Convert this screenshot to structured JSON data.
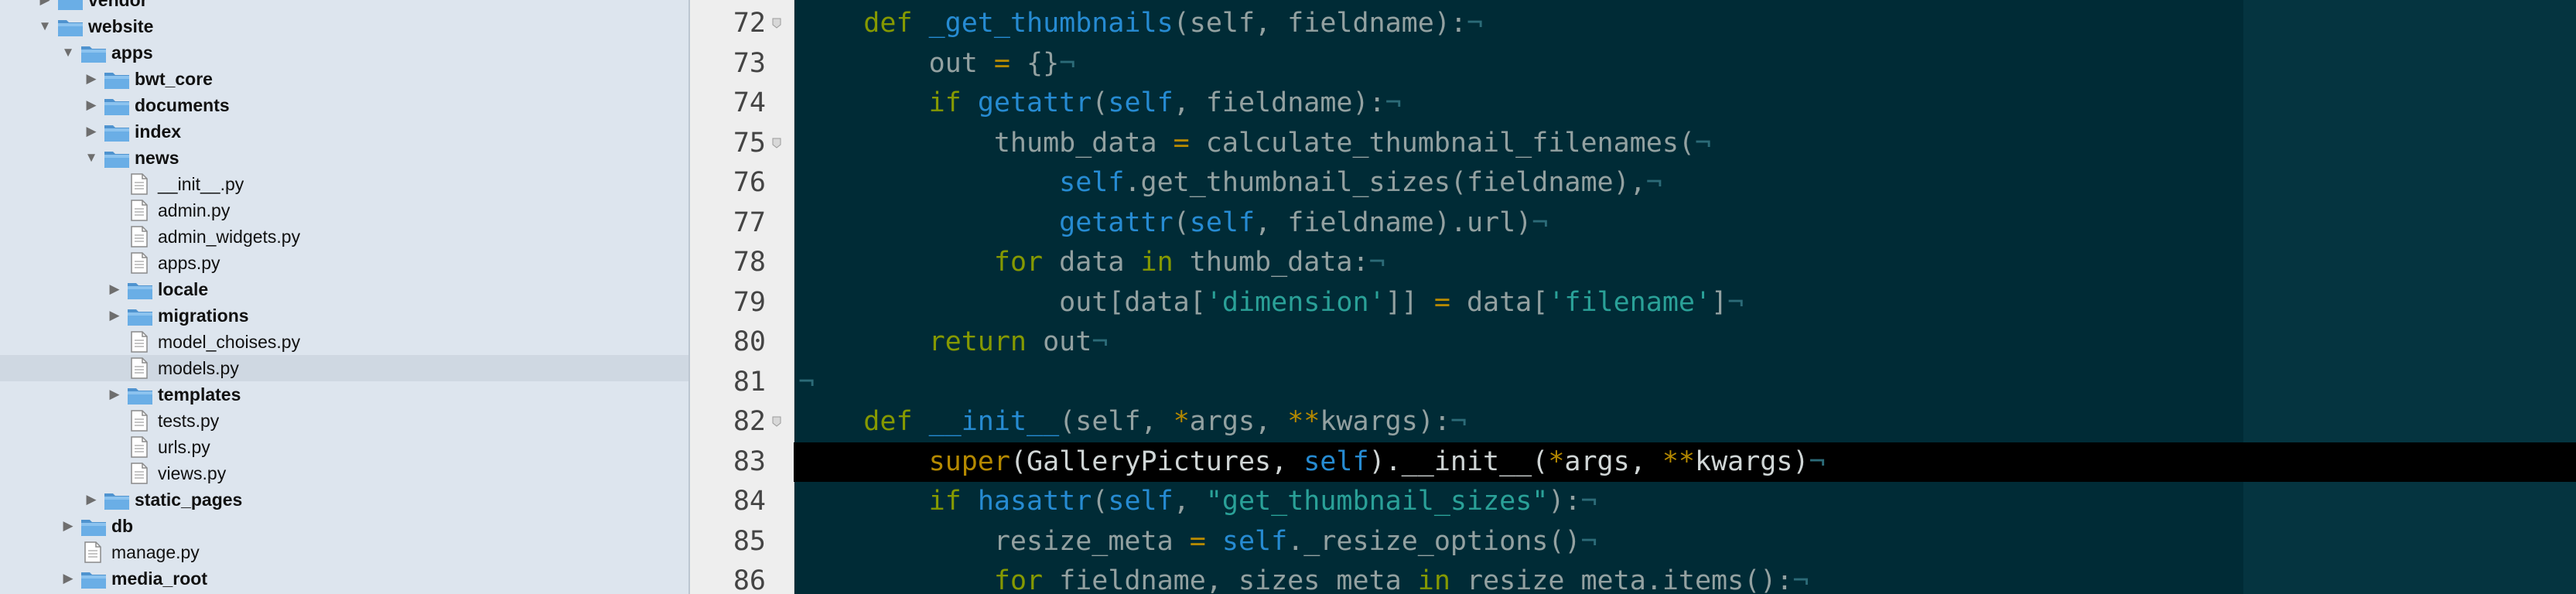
{
  "colors": {
    "sidebar_bg": "#dde5ee",
    "editor_bg": "#002b36",
    "current_line_bg": "#000000",
    "keyword": "#859900",
    "function": "#268bd2",
    "string": "#2aa198",
    "operator": "#b58900",
    "folder_icon": "#6aaee6"
  },
  "sidebar": {
    "items": [
      {
        "label": "vendor",
        "type": "folder",
        "depth": 1,
        "state": "collapsed"
      },
      {
        "label": "website",
        "type": "folder",
        "depth": 1,
        "state": "expanded"
      },
      {
        "label": "apps",
        "type": "folder",
        "depth": 2,
        "state": "expanded"
      },
      {
        "label": "bwt_core",
        "type": "folder",
        "depth": 3,
        "state": "collapsed"
      },
      {
        "label": "documents",
        "type": "folder",
        "depth": 3,
        "state": "collapsed"
      },
      {
        "label": "index",
        "type": "folder",
        "depth": 3,
        "state": "collapsed"
      },
      {
        "label": "news",
        "type": "folder",
        "depth": 3,
        "state": "expanded"
      },
      {
        "label": "__init__.py",
        "type": "file",
        "depth": 4
      },
      {
        "label": "admin.py",
        "type": "file",
        "depth": 4
      },
      {
        "label": "admin_widgets.py",
        "type": "file",
        "depth": 4
      },
      {
        "label": "apps.py",
        "type": "file",
        "depth": 4
      },
      {
        "label": "locale",
        "type": "folder",
        "depth": 4,
        "state": "collapsed"
      },
      {
        "label": "migrations",
        "type": "folder",
        "depth": 4,
        "state": "collapsed"
      },
      {
        "label": "model_choises.py",
        "type": "file",
        "depth": 4
      },
      {
        "label": "models.py",
        "type": "file",
        "depth": 4,
        "selected": true
      },
      {
        "label": "templates",
        "type": "folder",
        "depth": 4,
        "state": "collapsed"
      },
      {
        "label": "tests.py",
        "type": "file",
        "depth": 4
      },
      {
        "label": "urls.py",
        "type": "file",
        "depth": 4
      },
      {
        "label": "views.py",
        "type": "file",
        "depth": 4
      },
      {
        "label": "static_pages",
        "type": "folder",
        "depth": 3,
        "state": "collapsed"
      },
      {
        "label": "db",
        "type": "folder",
        "depth": 2,
        "state": "collapsed"
      },
      {
        "label": "manage.py",
        "type": "file",
        "depth": 2
      },
      {
        "label": "media_root",
        "type": "folder",
        "depth": 2,
        "state": "collapsed"
      },
      {
        "label": "",
        "type": "folder",
        "depth": 2,
        "state": "collapsed"
      }
    ]
  },
  "editor": {
    "current_line": 83,
    "lines": [
      {
        "n": "72",
        "fold": true,
        "tokens": [
          [
            "p",
            "    "
          ],
          [
            "kw",
            "def"
          ],
          [
            "p",
            " "
          ],
          [
            "fn",
            "_get_thumbnails"
          ],
          [
            "p",
            "(self, fieldname):"
          ],
          [
            "eol",
            "¬"
          ]
        ]
      },
      {
        "n": "73",
        "fold": false,
        "tokens": [
          [
            "p",
            "        out "
          ],
          [
            "op",
            "="
          ],
          [
            "p",
            " {}"
          ],
          [
            "eol",
            "¬"
          ]
        ]
      },
      {
        "n": "74",
        "fold": false,
        "tokens": [
          [
            "p",
            "        "
          ],
          [
            "kw",
            "if"
          ],
          [
            "p",
            " "
          ],
          [
            "fn",
            "getattr"
          ],
          [
            "p",
            "("
          ],
          [
            "self",
            "self"
          ],
          [
            "p",
            ", fieldname):"
          ],
          [
            "eol",
            "¬"
          ]
        ]
      },
      {
        "n": "75",
        "fold": true,
        "tokens": [
          [
            "p",
            "            thumb_data "
          ],
          [
            "op",
            "="
          ],
          [
            "p",
            " calculate_thumbnail_filenames("
          ],
          [
            "eol",
            "¬"
          ]
        ]
      },
      {
        "n": "76",
        "fold": false,
        "tokens": [
          [
            "p",
            "                "
          ],
          [
            "self",
            "self"
          ],
          [
            "p",
            ".get_thumbnail_sizes(fieldname),"
          ],
          [
            "eol",
            "¬"
          ]
        ]
      },
      {
        "n": "77",
        "fold": false,
        "tokens": [
          [
            "p",
            "                "
          ],
          [
            "fn",
            "getattr"
          ],
          [
            "p",
            "("
          ],
          [
            "self",
            "self"
          ],
          [
            "p",
            ", fieldname).url)"
          ],
          [
            "eol",
            "¬"
          ]
        ]
      },
      {
        "n": "78",
        "fold": false,
        "tokens": [
          [
            "p",
            "            "
          ],
          [
            "kw",
            "for"
          ],
          [
            "p",
            " data "
          ],
          [
            "kw",
            "in"
          ],
          [
            "p",
            " thumb_data:"
          ],
          [
            "eol",
            "¬"
          ]
        ]
      },
      {
        "n": "79",
        "fold": false,
        "tokens": [
          [
            "p",
            "                out[data["
          ],
          [
            "str",
            "'dimension'"
          ],
          [
            "p",
            "]] "
          ],
          [
            "op",
            "="
          ],
          [
            "p",
            " data["
          ],
          [
            "str",
            "'filename'"
          ],
          [
            "p",
            "]"
          ],
          [
            "eol",
            "¬"
          ]
        ]
      },
      {
        "n": "80",
        "fold": false,
        "tokens": [
          [
            "p",
            "        "
          ],
          [
            "kw",
            "return"
          ],
          [
            "p",
            " out"
          ],
          [
            "eol",
            "¬"
          ]
        ]
      },
      {
        "n": "81",
        "fold": false,
        "tokens": [
          [
            "eol",
            "¬"
          ]
        ]
      },
      {
        "n": "82",
        "fold": true,
        "tokens": [
          [
            "p",
            "    "
          ],
          [
            "kw",
            "def"
          ],
          [
            "p",
            " "
          ],
          [
            "fn",
            "__init__"
          ],
          [
            "p",
            "(self, "
          ],
          [
            "op",
            "*"
          ],
          [
            "p",
            "args, "
          ],
          [
            "op",
            "**"
          ],
          [
            "p",
            "kwargs):"
          ],
          [
            "eol",
            "¬"
          ]
        ]
      },
      {
        "n": "83",
        "fold": false,
        "tokens": [
          [
            "p",
            "        "
          ],
          [
            "op",
            "super"
          ],
          [
            "p",
            "(GalleryPictures, "
          ],
          [
            "self",
            "self"
          ],
          [
            "p",
            ").__init__("
          ],
          [
            "op",
            "*"
          ],
          [
            "p",
            "args, "
          ],
          [
            "op",
            "**"
          ],
          [
            "p",
            "kwargs)"
          ],
          [
            "eol",
            "¬"
          ]
        ]
      },
      {
        "n": "84",
        "fold": false,
        "tokens": [
          [
            "p",
            "        "
          ],
          [
            "kw",
            "if"
          ],
          [
            "p",
            " "
          ],
          [
            "fn",
            "hasattr"
          ],
          [
            "p",
            "("
          ],
          [
            "self",
            "self"
          ],
          [
            "p",
            ", "
          ],
          [
            "str",
            "\"get_thumbnail_sizes\""
          ],
          [
            "p",
            "):"
          ],
          [
            "eol",
            "¬"
          ]
        ]
      },
      {
        "n": "85",
        "fold": false,
        "tokens": [
          [
            "p",
            "            resize_meta "
          ],
          [
            "op",
            "="
          ],
          [
            "p",
            " "
          ],
          [
            "self",
            "self"
          ],
          [
            "p",
            "._resize_options()"
          ],
          [
            "eol",
            "¬"
          ]
        ]
      },
      {
        "n": "86",
        "fold": false,
        "tokens": [
          [
            "p",
            "            "
          ],
          [
            "kw",
            "for"
          ],
          [
            "p",
            " fieldname, sizes_meta "
          ],
          [
            "kw",
            "in"
          ],
          [
            "p",
            " resize_meta.items():"
          ],
          [
            "eol",
            "¬"
          ]
        ]
      }
    ]
  }
}
